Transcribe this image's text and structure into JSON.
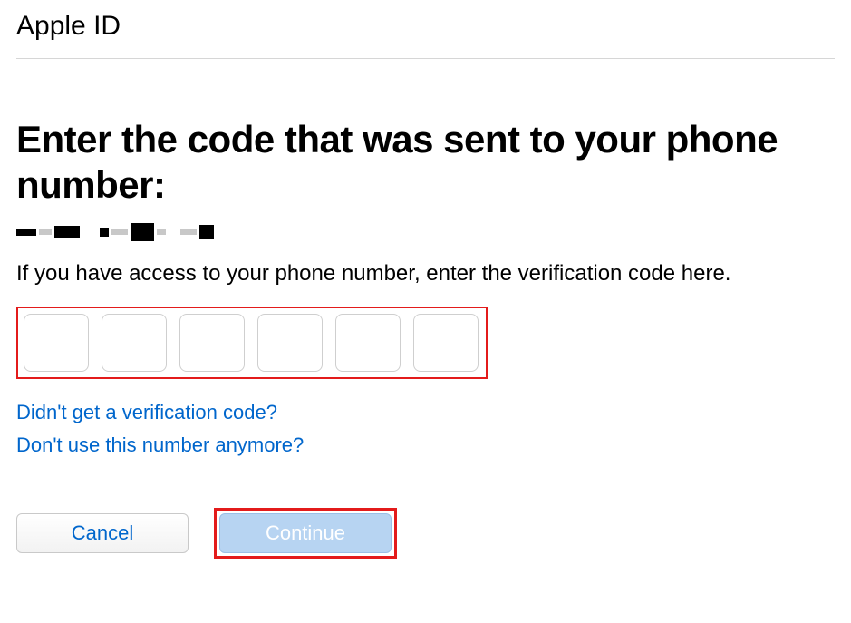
{
  "header": {
    "title": "Apple ID"
  },
  "main": {
    "heading": "Enter the code that was sent to your phone number:",
    "phone_redacted": true,
    "instruction": "If you have access to your phone number, enter the verification code here.",
    "code_digits": [
      "",
      "",
      "",
      "",
      "",
      ""
    ]
  },
  "links": {
    "no_code": "Didn't get a verification code?",
    "no_number": "Don't use this number anymore?"
  },
  "buttons": {
    "cancel": "Cancel",
    "continue": "Continue"
  },
  "colors": {
    "highlight_border": "#e31b1b",
    "link": "#0066cc",
    "continue_bg": "#b7d4f2"
  }
}
